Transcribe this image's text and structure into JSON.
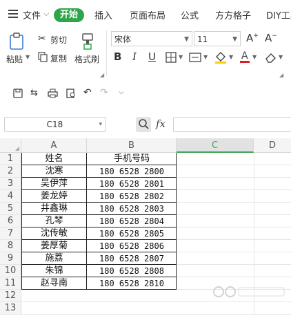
{
  "menu": {
    "file_label": "文件",
    "start_label": "开始",
    "tabs": [
      "插入",
      "页面布局",
      "公式",
      "方方格子",
      "DIY工具"
    ]
  },
  "ribbon": {
    "paste_label": "粘贴",
    "cut_label": "剪切",
    "copy_label": "复制",
    "format_painter_label": "格式刷",
    "font_name": "宋体",
    "font_size": "11"
  },
  "formula_bar": {
    "name_box": "C18",
    "fx_label": "fx",
    "value": ""
  },
  "sheet": {
    "columns": [
      "A",
      "B",
      "C",
      "D"
    ],
    "row_numbers": [
      "1",
      "2",
      "3",
      "4",
      "5",
      "6",
      "7",
      "8",
      "9",
      "10",
      "11",
      "12",
      "13"
    ],
    "header": {
      "name": "姓名",
      "phone": "手机号码"
    },
    "rows": [
      {
        "name": "沈寒",
        "phone": "180 6528 2800"
      },
      {
        "name": "吴伊萍",
        "phone": "180 6528 2801"
      },
      {
        "name": "姜龙婷",
        "phone": "180 6528 2802"
      },
      {
        "name": "井鑫琳",
        "phone": "180 6528 2803"
      },
      {
        "name": "孔琴",
        "phone": "180 6528 2804"
      },
      {
        "name": "沈传敏",
        "phone": "180 6528 2805"
      },
      {
        "name": "姜厚菊",
        "phone": "180 6528 2806"
      },
      {
        "name": "施荔",
        "phone": "180 6528 2807"
      },
      {
        "name": "朱锦",
        "phone": "180 6528 2808"
      },
      {
        "name": "赵寻南",
        "phone": "180 6528 2810"
      }
    ]
  },
  "colors": {
    "accent_green": "#2fa54a",
    "selected_col": "#3aa655"
  }
}
